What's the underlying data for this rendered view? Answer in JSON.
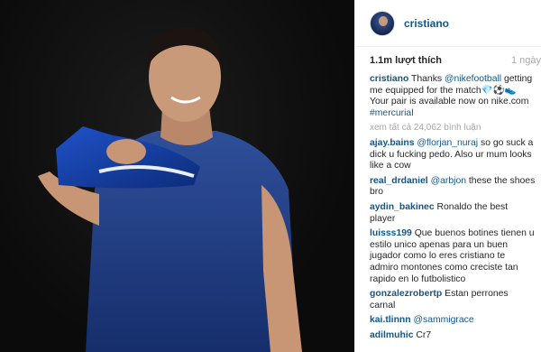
{
  "post": {
    "username": "cristiano",
    "likes": "1.1m lượt thích",
    "time": "1 ngày",
    "view_all": "xem tất cả 24,062 bình luận"
  },
  "caption": {
    "user": "cristiano",
    "pre": "Thanks ",
    "mention": "@nikefootball",
    "text": " getting me equipped for the match💎⚽👟 Your pair is available now on nike.com ",
    "hashtag": "#mercurial"
  },
  "comments": [
    {
      "user": "ajay.bains",
      "mention": "@florjan_nuraj",
      "text": " so go suck a dick u fucking pedo. Also ur mum looks like a cow"
    },
    {
      "user": "real_drdaniel",
      "mention": "@arbjon",
      "text": " these the shoes bro"
    },
    {
      "user": "aydin_bakinec",
      "mention": "",
      "text": "Ronaldo the best player"
    },
    {
      "user": "luisss199",
      "mention": "",
      "text": "Que buenos botines tienen u estilo unico apenas para un buen jugador como lo eres cristiano te admiro montones como creciste tan rapido en lo futbolistico"
    },
    {
      "user": "gonzalezrobertp",
      "mention": "",
      "text": "Estan perrones carnal"
    },
    {
      "user": "kai.tlinnn",
      "mention": "@sammigrace",
      "text": ""
    },
    {
      "user": "adilmuhic",
      "mention": "",
      "text": "Cr7"
    }
  ],
  "colors": {
    "link": "#125688",
    "muted": "#a5a7aa",
    "text": "#262626"
  }
}
